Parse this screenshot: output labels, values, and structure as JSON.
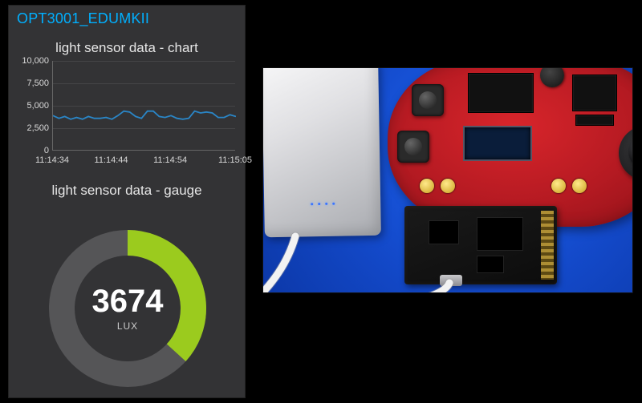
{
  "panel": {
    "title": "OPT3001_EDUMKII",
    "chart_title": "light sensor data - chart",
    "gauge_title": "light sensor data - gauge"
  },
  "gauge": {
    "value": 3674,
    "value_text": "3674",
    "unit": "LUX",
    "min": 0,
    "max": 10000,
    "fill_color": "#9bcb1e",
    "track_color": "#555557"
  },
  "chart_data": {
    "type": "line",
    "title": "light sensor data - chart",
    "xlabel": "",
    "ylabel": "",
    "ylim": [
      0,
      10000
    ],
    "y_ticks": [
      0,
      2500,
      5000,
      7500,
      10000
    ],
    "y_tick_labels": [
      "0",
      "2,500",
      "5,000",
      "7,500",
      "10,000"
    ],
    "x_ticks_seconds": [
      0,
      10,
      20,
      31
    ],
    "x_tick_labels": [
      "11:14:34",
      "11:14:44",
      "11:14:54",
      "11:15:05"
    ],
    "series": [
      {
        "name": "lux",
        "color": "#2a86c7",
        "x_seconds": [
          0,
          1,
          2,
          3,
          4,
          5,
          6,
          7,
          8,
          9,
          10,
          11,
          12,
          13,
          14,
          15,
          16,
          17,
          18,
          19,
          20,
          21,
          22,
          23,
          24,
          25,
          26,
          27,
          28,
          29,
          30,
          31
        ],
        "values": [
          3900,
          3600,
          3800,
          3500,
          3700,
          3500,
          3800,
          3600,
          3600,
          3700,
          3500,
          3900,
          4400,
          4300,
          3800,
          3600,
          4400,
          4400,
          3800,
          3700,
          3900,
          3600,
          3500,
          3600,
          4400,
          4200,
          4300,
          4200,
          3700,
          3700,
          4000,
          3800
        ]
      }
    ]
  },
  "photo": {
    "description": "Hardware photo: silver USB power bank (left), red oval development board with push buttons, LCD, buzzer, joystick (right), small black daughter board with micro-USB (center-bottom), white USB cables, on a blue background.",
    "powerbank_leds": 4
  }
}
